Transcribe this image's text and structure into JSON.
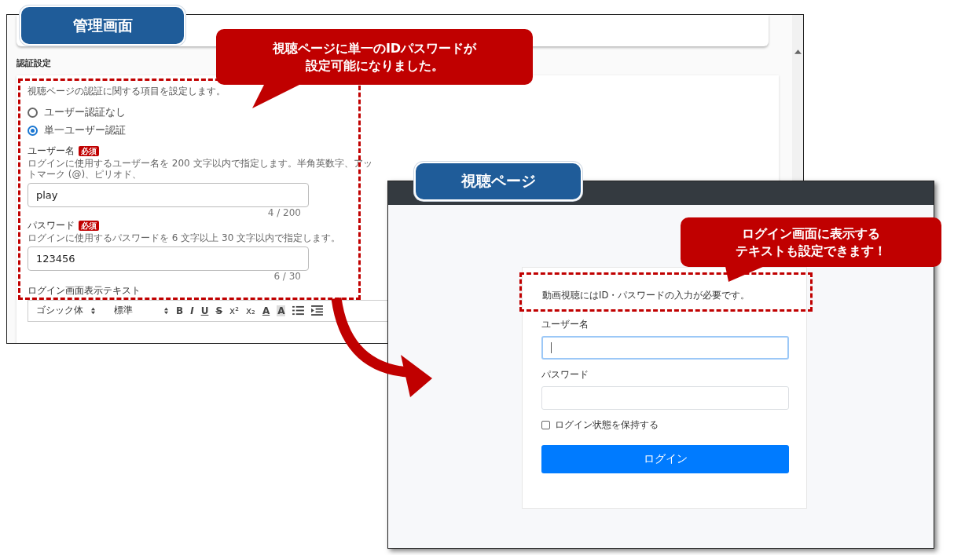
{
  "admin_screen": {
    "label": "管理画面",
    "section_title": "認証設定",
    "description": "視聴ページの認証に関する項目を設定します。",
    "auth_options": [
      {
        "label": "ユーザー認証なし",
        "selected": false
      },
      {
        "label": "単一ユーザー認証",
        "selected": true
      }
    ],
    "fields": [
      {
        "label": "ユーザー名",
        "badge": "必須",
        "help": "ログインに使用するユーザー名を 200 文字以内で指定します。半角英数字、アットマーク (@)、ピリオド、",
        "value": "play",
        "counter": "4 / 200"
      },
      {
        "label": "パスワード",
        "badge": "必須",
        "help": "ログインに使用するパスワードを 6 文字以上 30 文字以内で指定します。",
        "value": "123456",
        "counter": "6 / 30"
      }
    ],
    "editor_label": "ログイン画面表示テキスト",
    "toolbar": {
      "font": "ゴシック体",
      "size": "標準",
      "buttons": [
        {
          "kind": "bold",
          "text": "B"
        },
        {
          "kind": "italic",
          "text": "I"
        },
        {
          "kind": "underline",
          "text": "U"
        },
        {
          "kind": "strike",
          "text": "S"
        },
        {
          "kind": "plain",
          "text": "x²"
        },
        {
          "kind": "plain",
          "text": "x₂"
        },
        {
          "kind": "underline",
          "text": "A"
        },
        {
          "kind": "highlight",
          "text": "A"
        }
      ]
    }
  },
  "viewer_screen": {
    "label": "視聴ページ",
    "message": "動画視聴にはID・パスワードの入力が必要です。",
    "fields": [
      {
        "label": "ユーザー名",
        "focused": true
      },
      {
        "label": "パスワード",
        "focused": false
      }
    ],
    "remember": {
      "label": "ログイン状態を保持する",
      "checked": false
    },
    "button": "ログイン"
  },
  "callouts": [
    {
      "lines": [
        "視聴ページに単一のIDパスワードが",
        "設定可能になりました。"
      ]
    },
    {
      "lines": [
        "ログイン画面に表示する",
        "テキストも設定できます！"
      ]
    }
  ]
}
